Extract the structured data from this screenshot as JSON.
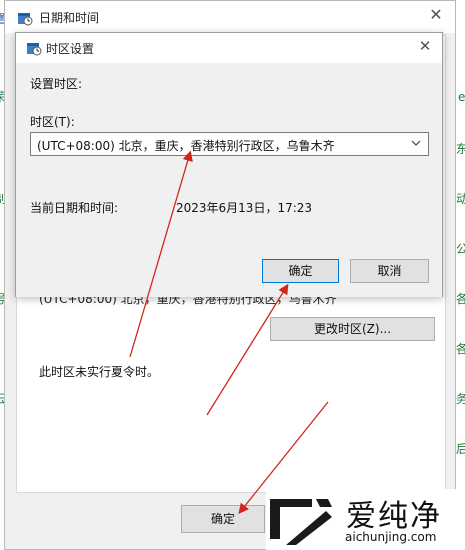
{
  "background_fragments": {
    "left": [
      "置",
      "荣",
      "制",
      "号",
      "云"
    ],
    "right": [
      "e",
      "东",
      "动",
      "公",
      "各",
      "各",
      "务",
      "后"
    ]
  },
  "outer_dialog": {
    "title": "日期和时间",
    "close_icon": "close-icon",
    "hidden_timezone_text": "(UTC+08:00) 北京，重庆，香港特别行政区，乌鲁木齐",
    "change_timezone_button": "更改时区(Z)...",
    "dst_note": "此时区未实行夏令时。",
    "ok_button": "确定"
  },
  "inner_dialog": {
    "title": "时区设置",
    "close_icon": "close-icon",
    "settings_label": "设置时区:",
    "timezone_label": "时区(T):",
    "timezone_value": "(UTC+08:00) 北京，重庆，香港特别行政区，乌鲁木齐",
    "current_label": "当前日期和时间:",
    "current_datetime": "2023年6月13日，17:23",
    "ok_button": "确定",
    "cancel_button": "取消"
  },
  "annotations": {
    "arrow_color": "#d0261c"
  },
  "watermark": {
    "brand_cn": "爱纯净",
    "brand_en": "aichunjing.com"
  }
}
